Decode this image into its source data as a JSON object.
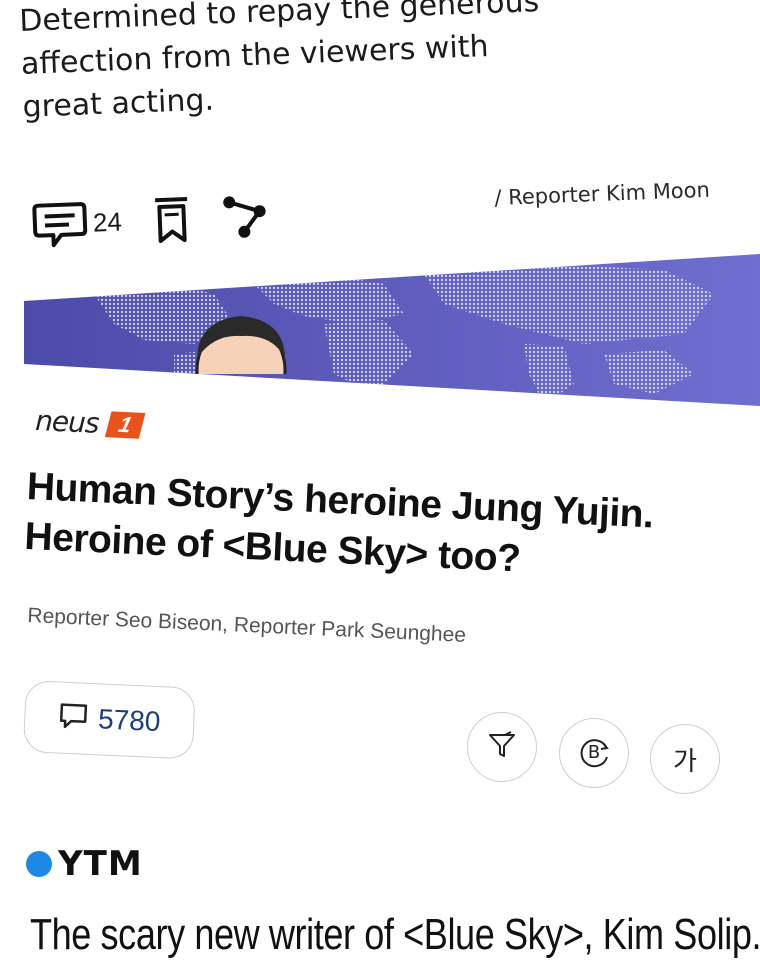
{
  "intro": {
    "lines": [
      "Determined to repay the generous",
      "affection from the viewers with",
      "great acting."
    ]
  },
  "article_actions": {
    "comment_count": "24",
    "reporter": "/ Reporter Kim Moon"
  },
  "news_card": {
    "logo_word": "neus",
    "logo_badge": "1",
    "headline_line1": "Human Story’s heroine Jung Yujin.",
    "headline_line2": "Heroine of <Blue Sky> too?",
    "byline": "Reporter Seo Biseon, Reporter Park Seunghee",
    "comment_count": "5780",
    "font_button": "가",
    "b_button": "B"
  },
  "ytm": {
    "logo_word": "YTM",
    "headline": "The scary new writer of <Blue Sky>, Kim Solip."
  },
  "colors": {
    "banner": "#4b49a8",
    "news_badge": "#e8531d",
    "ytm_dot": "#1e88e5",
    "comment_blue": "#1c3f7a"
  }
}
